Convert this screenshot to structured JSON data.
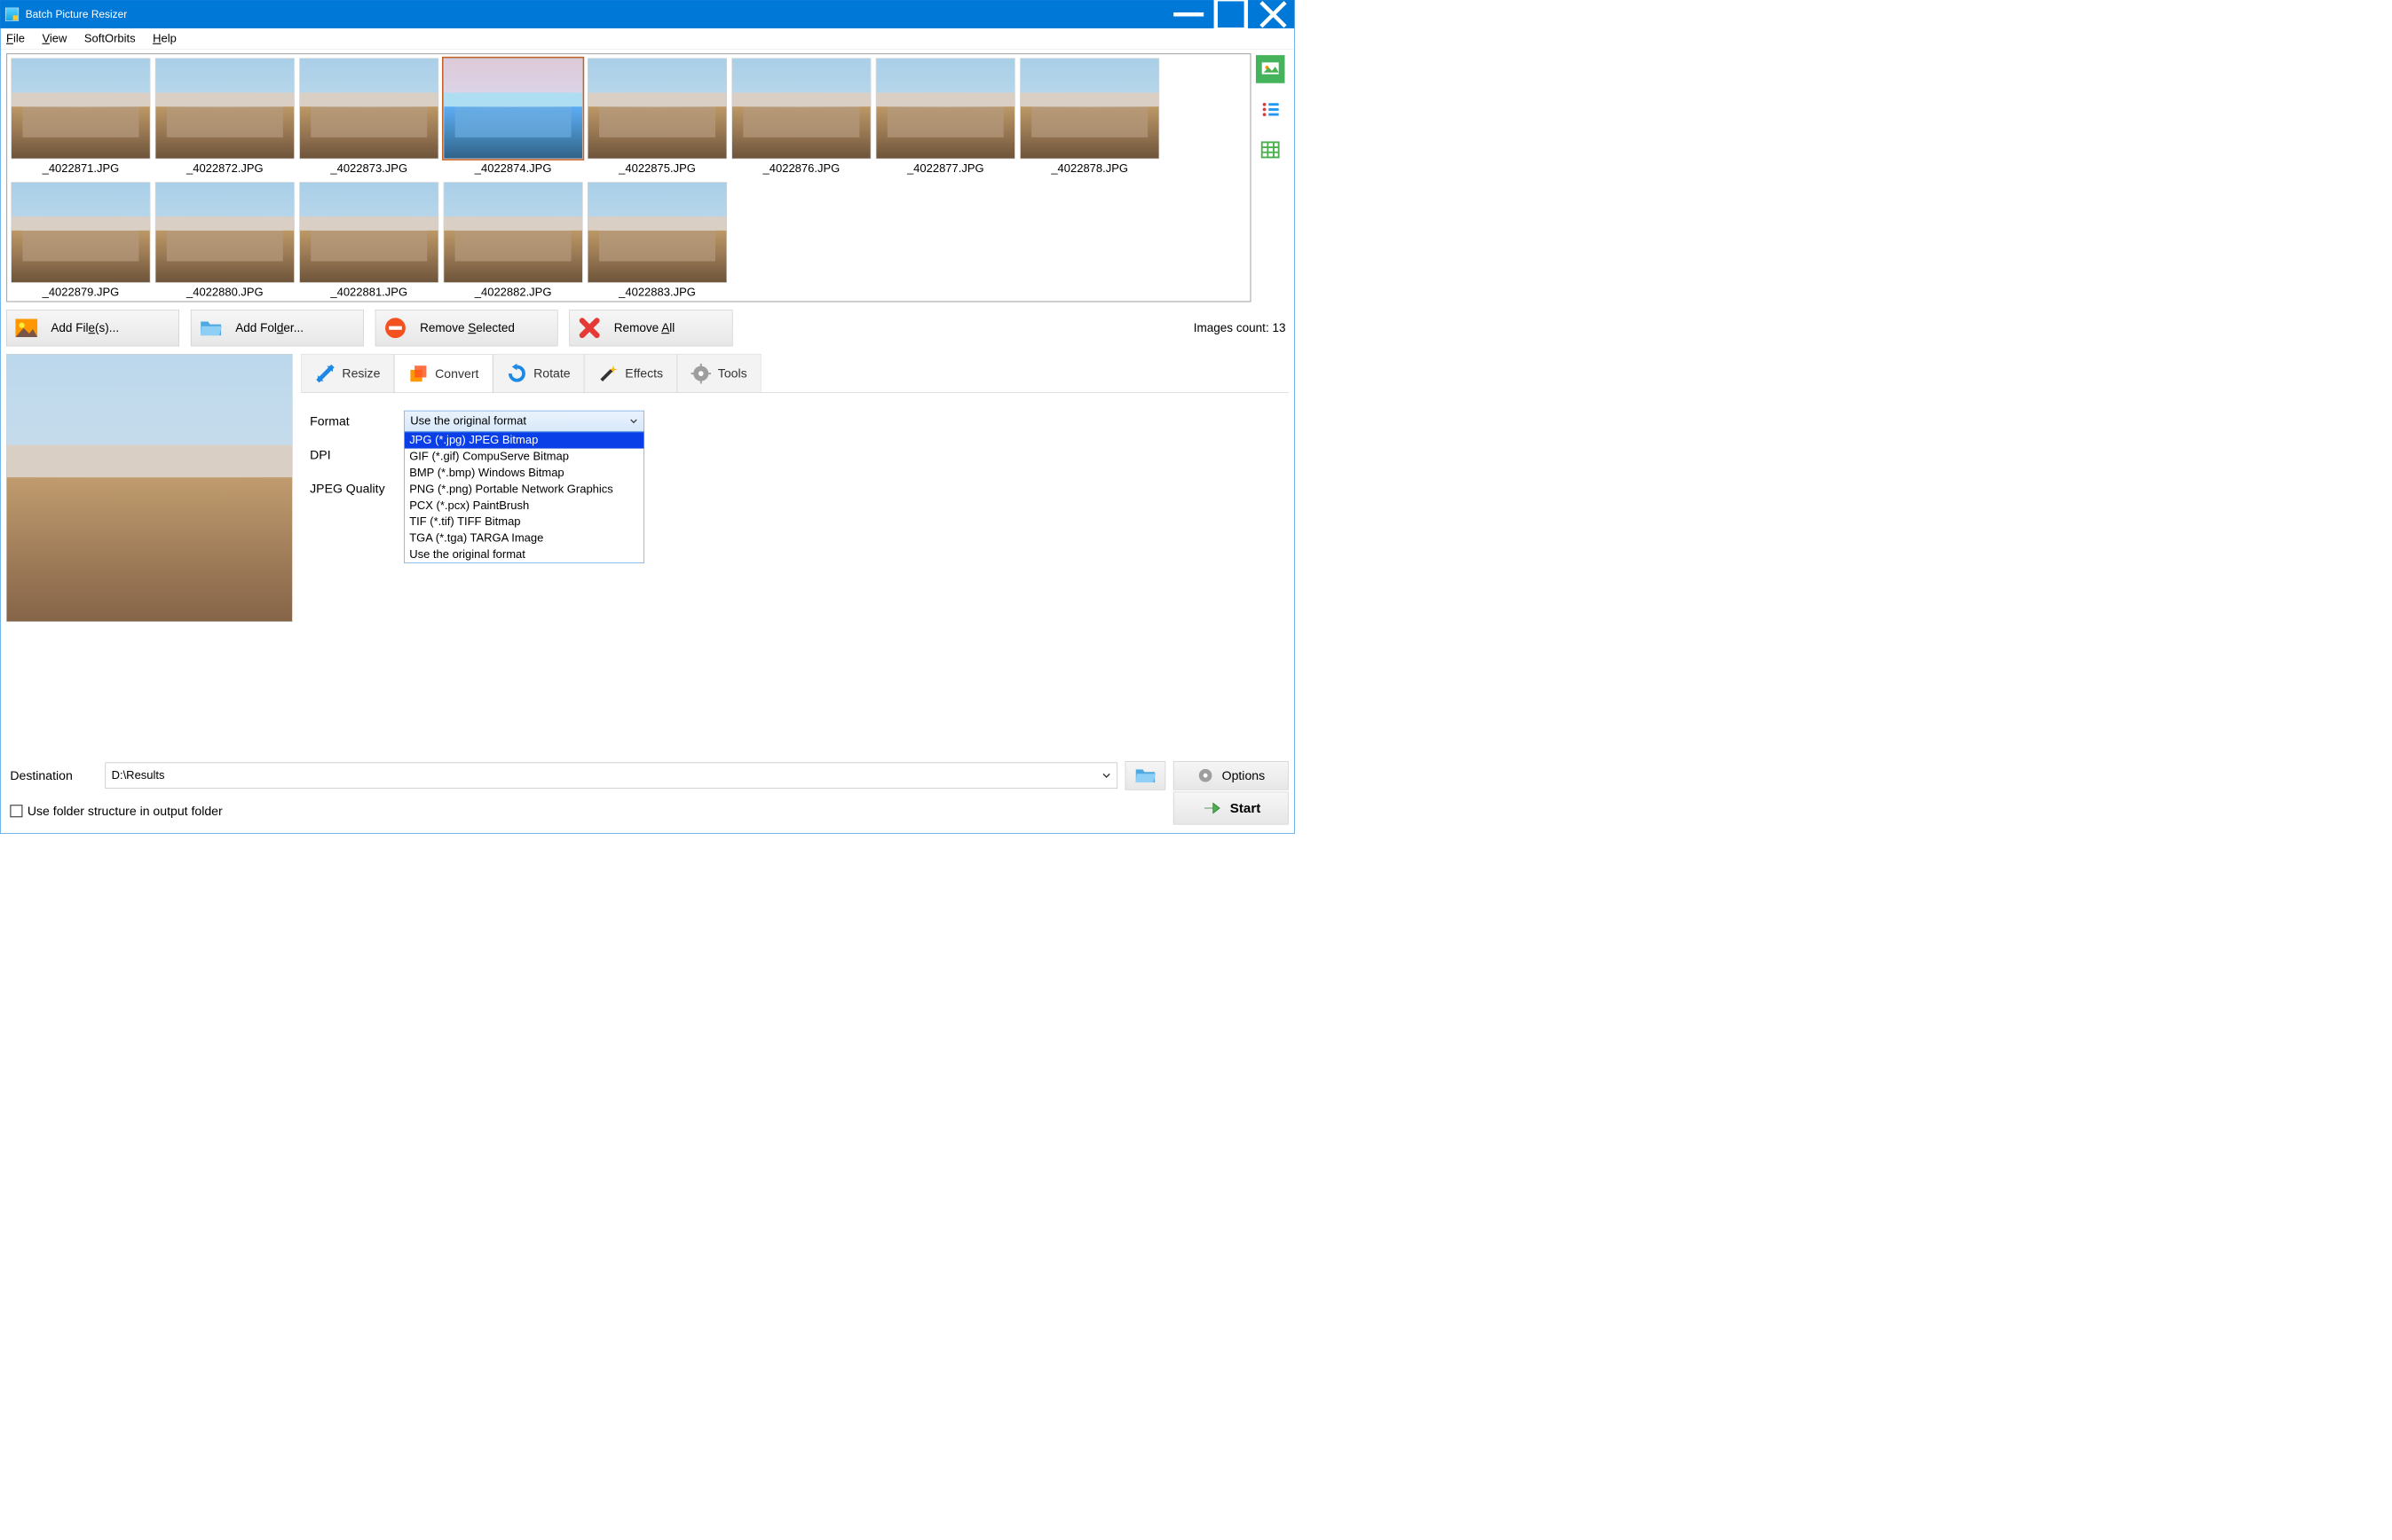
{
  "title": "Batch Picture Resizer",
  "menu": {
    "file": "File",
    "view": "View",
    "softorbits": "SoftOrbits",
    "help": "Help"
  },
  "thumbs": [
    {
      "name": "_4022871.JPG"
    },
    {
      "name": "_4022872.JPG"
    },
    {
      "name": "_4022873.JPG"
    },
    {
      "name": "_4022874.JPG",
      "selected": true
    },
    {
      "name": "_4022875.JPG"
    },
    {
      "name": "_4022876.JPG"
    },
    {
      "name": "_4022877.JPG"
    },
    {
      "name": "_4022878.JPG"
    },
    {
      "name": "_4022879.JPG"
    },
    {
      "name": "_4022880.JPG"
    },
    {
      "name": "_4022881.JPG"
    },
    {
      "name": "_4022882.JPG"
    },
    {
      "name": "_4022883.JPG"
    }
  ],
  "toolbar": {
    "add_files": "Add File(s)...",
    "add_folder": "Add Folder...",
    "remove_selected": "Remove Selected",
    "remove_all": "Remove All"
  },
  "count_label": "Images count: 13",
  "tabs": {
    "resize": "Resize",
    "convert": "Convert",
    "rotate": "Rotate",
    "effects": "Effects",
    "tools": "Tools"
  },
  "convert": {
    "format_label": "Format",
    "dpi_label": "DPI",
    "quality_label": "JPEG Quality",
    "selected": "Use the original format",
    "options": [
      "JPG (*.jpg) JPEG Bitmap",
      "GIF (*.gif) CompuServe Bitmap",
      "BMP (*.bmp) Windows Bitmap",
      "PNG (*.png) Portable Network Graphics",
      "PCX (*.pcx) PaintBrush",
      "TIF (*.tif) TIFF Bitmap",
      "TGA (*.tga) TARGA Image",
      "Use the original format"
    ]
  },
  "destination": {
    "label": "Destination",
    "value": "D:\\Results"
  },
  "options_btn": "Options",
  "use_folder_structure": "Use folder structure in output folder",
  "start_btn": "Start"
}
